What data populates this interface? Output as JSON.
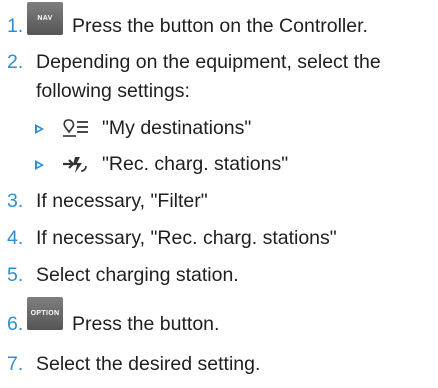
{
  "steps": [
    {
      "num": "1.",
      "button_label": "NAV",
      "text": "Press the button on the Controller."
    },
    {
      "num": "2.",
      "text_line1": "Depending on the equipment, select the",
      "text_line2": "following settings:"
    },
    {
      "num": "3.",
      "text": "If necessary, \"Filter\""
    },
    {
      "num": "4.",
      "text": "If necessary, \"Rec. charg. stations\""
    },
    {
      "num": "5.",
      "text": "Select charging station."
    },
    {
      "num": "6.",
      "button_label": "OPTION",
      "text": "Press the button."
    },
    {
      "num": "7.",
      "text": "Select the desired setting."
    }
  ],
  "sub_items": [
    {
      "icon": "my-destinations-icon",
      "text": "\"My destinations\""
    },
    {
      "icon": "charging-station-icon",
      "text": "\"Rec. charg. stations\""
    }
  ],
  "colors": {
    "accent": "#2d8fd3",
    "text": "#1f1f1f",
    "button": "#666666"
  }
}
